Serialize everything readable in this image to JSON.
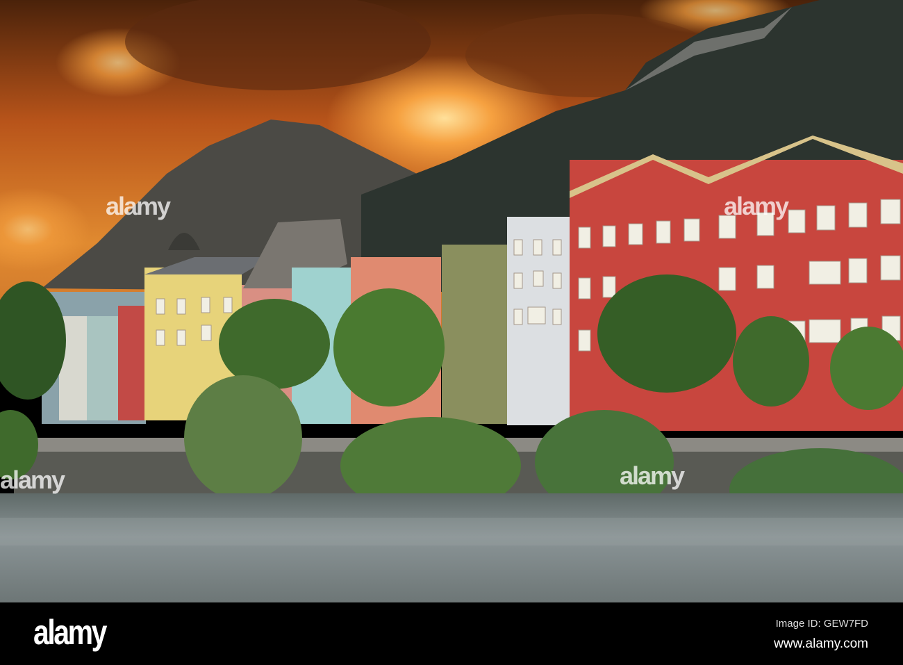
{
  "photo": {
    "subject": "Colorful houses along river below mountains at sunset",
    "colors": {
      "sky_top": "#5a2a0c",
      "sky_glow": "#f0902a",
      "mountain": "#2e3530",
      "river": "#7f8a8c",
      "red_building": "#c8463e",
      "foliage": "#3f6a2c"
    }
  },
  "watermark": {
    "text": "alamy"
  },
  "footer": {
    "logo": "alamy",
    "image_id": "Image ID: GEW7FD",
    "website": "www.alamy.com"
  }
}
